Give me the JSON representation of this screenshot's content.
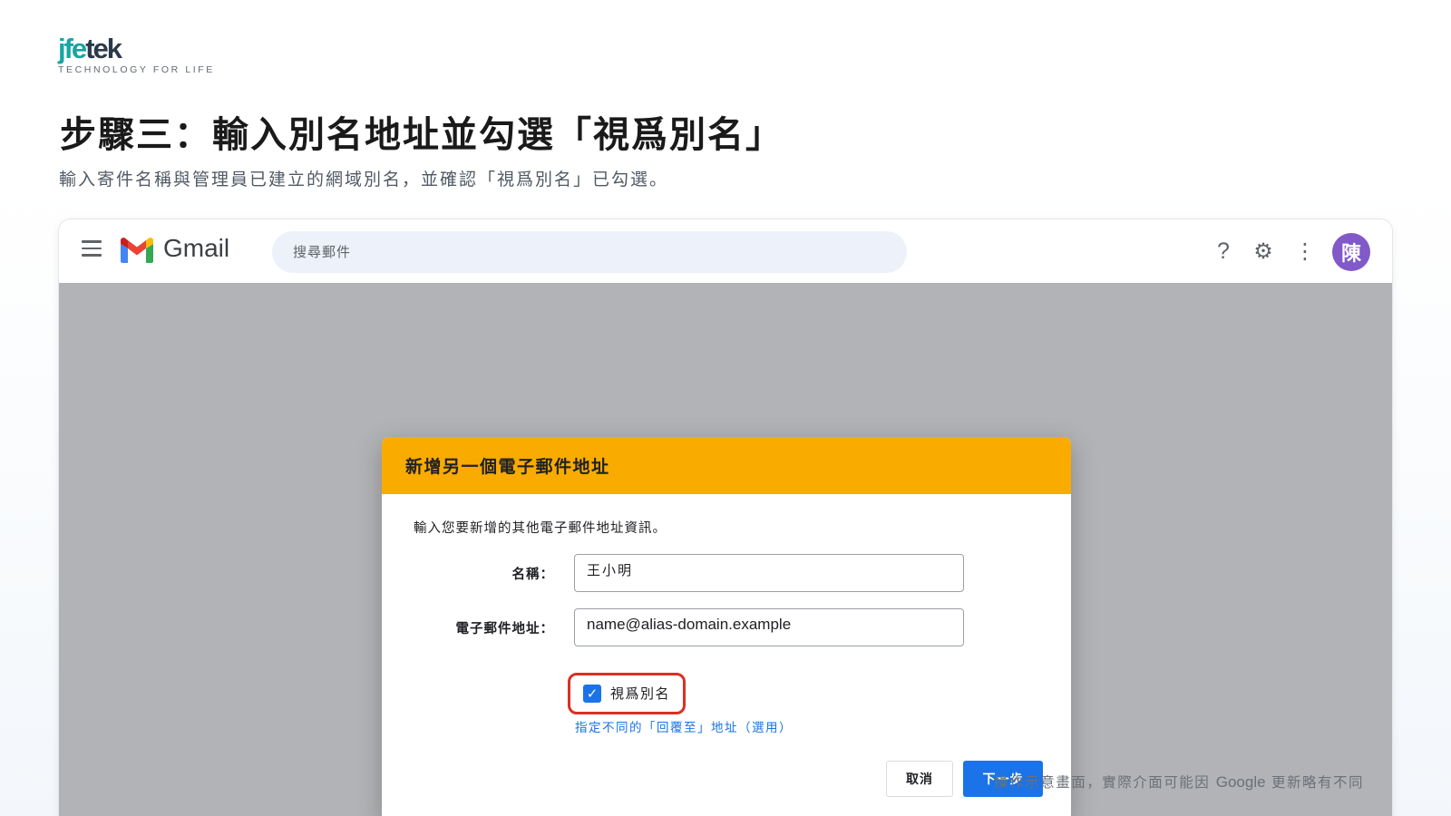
{
  "brand": {
    "logo_part1": "jfe",
    "logo_part2": "tek",
    "tagline": "TECHNOLOGY FOR LIFE"
  },
  "slide": {
    "title": "步驟三：輸入別名地址並勾選「視爲別名」",
    "subtitle": "輸入寄件名稱與管理員已建立的網域別名，並確認「視爲別名」已勾選。"
  },
  "gmail": {
    "app_name": "Gmail",
    "search_placeholder": "搜尋郵件",
    "avatar_initial": "陳",
    "help_glyph": "?",
    "settings_glyph": "⚙",
    "more_glyph": "⋮"
  },
  "dialog": {
    "title": "新增另一個電子郵件地址",
    "description": "輸入您要新增的其他電子郵件地址資訊。",
    "name_label": "名稱：",
    "name_value": "王小明",
    "email_label": "電子郵件地址：",
    "email_value": "name@alias-domain.example",
    "alias_checkbox_label": "視爲別名",
    "alias_checked": true,
    "checkmark": "✓",
    "reply_to_link": "指定不同的「回覆至」地址（選用）",
    "cancel_label": "取消",
    "next_label": "下一步"
  },
  "footnote": {
    "before": "操作示意畫面，實際介面可能因 ",
    "brand": "Google",
    "after": " 更新略有不同"
  },
  "colors": {
    "dialog_header": "#f9ab00",
    "primary_button": "#1a73e8",
    "highlight_ring": "#d93025",
    "avatar": "#8159c8"
  }
}
